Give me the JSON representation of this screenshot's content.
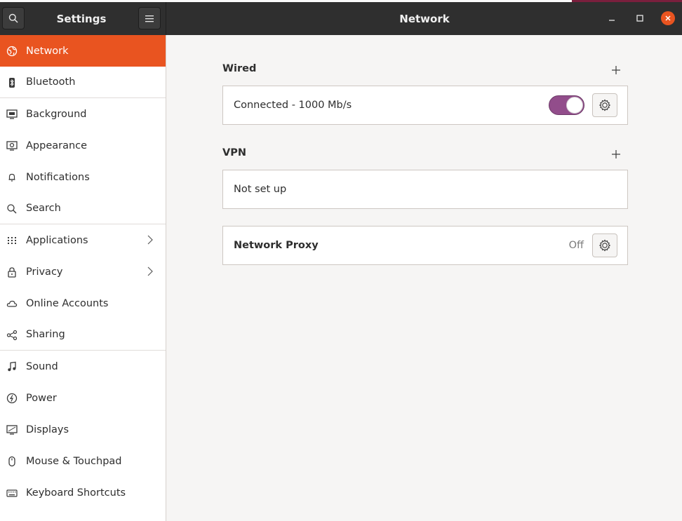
{
  "window": {
    "left_title": "Settings",
    "main_title": "Network"
  },
  "sidebar": {
    "items": [
      {
        "label": "Network",
        "icon": "network-icon"
      },
      {
        "label": "Bluetooth",
        "icon": "bluetooth-icon"
      },
      {
        "label": "Background",
        "icon": "background-icon"
      },
      {
        "label": "Appearance",
        "icon": "appearance-icon"
      },
      {
        "label": "Notifications",
        "icon": "bell-icon"
      },
      {
        "label": "Search",
        "icon": "search-icon"
      },
      {
        "label": "Applications",
        "icon": "grid-icon"
      },
      {
        "label": "Privacy",
        "icon": "lock-icon"
      },
      {
        "label": "Online Accounts",
        "icon": "cloud-icon"
      },
      {
        "label": "Sharing",
        "icon": "share-icon"
      },
      {
        "label": "Sound",
        "icon": "music-note-icon"
      },
      {
        "label": "Power",
        "icon": "power-icon"
      },
      {
        "label": "Displays",
        "icon": "display-icon"
      },
      {
        "label": "Mouse & Touchpad",
        "icon": "mouse-icon"
      },
      {
        "label": "Keyboard Shortcuts",
        "icon": "keyboard-icon"
      }
    ]
  },
  "wired": {
    "title": "Wired",
    "status": "Connected - 1000 Mb/s",
    "enabled": true
  },
  "vpn": {
    "title": "VPN",
    "status": "Not set up"
  },
  "proxy": {
    "title": "Network Proxy",
    "state": "Off"
  },
  "colors": {
    "accent": "#e95420",
    "toggle_on": "#924d8b",
    "headerbar": "#2f2f2f"
  }
}
